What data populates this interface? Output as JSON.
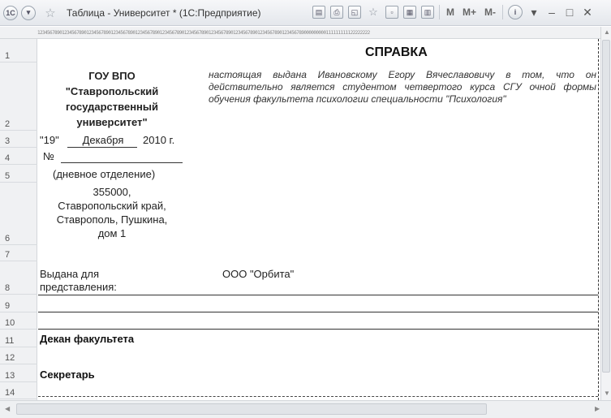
{
  "window": {
    "title": "Таблица - Университет * (1С:Предприятие)",
    "logo_text": "1С",
    "m_label": "M",
    "mplus_label": "M+",
    "mminus_label": "M-"
  },
  "ruler_text": "1234567890123456789012345678901234567890123456789012345678901234567890123456789012345678901234567890123456789000000000111111111122222222",
  "row_numbers": [
    "1",
    "2",
    "3",
    "4",
    "5",
    "6",
    "7",
    "8",
    "9",
    "10",
    "11",
    "12",
    "13",
    "14"
  ],
  "org": {
    "line1": "ГОУ ВПО",
    "line2": "\"Ставропольский",
    "line3": "государственный",
    "line4": "университет\""
  },
  "doc_title": "СПРАВКА",
  "body_text": "настоящая выдана Ивановскому Егору Вячеславовичу в том, что он действительно является студентом четвертого курса СГУ очной формы обучения факультета психологии специальности \"Психология\"",
  "date": {
    "day": "\"19\"",
    "month": "Декабря",
    "year": "2010 г."
  },
  "number_label": "№",
  "department": "(дневное отделение)",
  "address": {
    "line1": "355000,",
    "line2": "Ставропольский край,",
    "line3": "Ставрополь, Пушкина,",
    "line4": "дом 1"
  },
  "issued_for": {
    "label_line1": "Выдана для",
    "label_line2": "представления:",
    "value": "ООО \"Орбита\""
  },
  "dean_label": "Декан факультета",
  "secretary_label": "Секретарь"
}
